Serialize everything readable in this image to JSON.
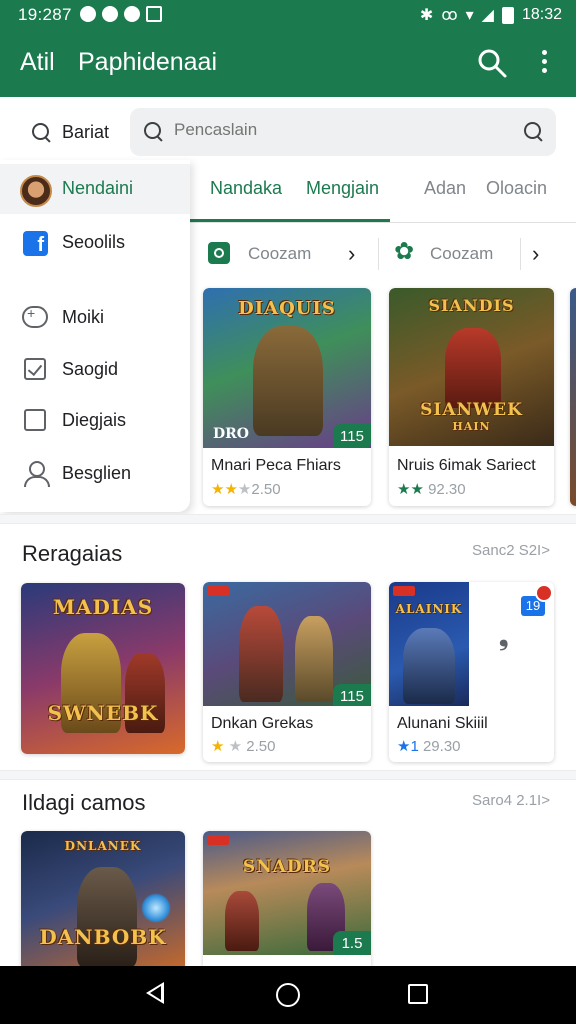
{
  "status_bar": {
    "time_left": "19:287",
    "time_right": "18:32"
  },
  "app_bar": {
    "brand": "Atil",
    "title": "Paphidenaai",
    "search_icon": "search-icon",
    "more_icon": "more-vert-icon"
  },
  "search": {
    "left_label": "Bariat",
    "placeholder": "Pencaslain"
  },
  "drawer": {
    "items": [
      {
        "label": "Nendaini",
        "icon": "avatar"
      },
      {
        "label": "Seoolils",
        "icon": "facebook-icon"
      },
      {
        "label": "Moiki",
        "icon": "gamepad-icon"
      },
      {
        "label": "Saogid",
        "icon": "checkbox-icon"
      },
      {
        "label": "Diegjais",
        "icon": "square-icon"
      },
      {
        "label": "Besglien",
        "icon": "person-icon"
      }
    ]
  },
  "tabs": [
    {
      "label": "Nandaka"
    },
    {
      "label": "Mengjain"
    },
    {
      "label": "Adan"
    },
    {
      "label": "Oloacin"
    }
  ],
  "chips": [
    {
      "label": "Coozam"
    },
    {
      "label": "Coozam"
    }
  ],
  "featured": {
    "cards": [
      {
        "art_title": "DIAQUIS",
        "art_sub": "DRO",
        "badge": "115",
        "name": "Mnari Peca Fhiars",
        "rating": "2.50"
      },
      {
        "art_title": "SIANDIS",
        "art_sub": "SIANWEK",
        "art_sub2": "HAIN",
        "badge": "",
        "name": "Nruis 6imak Sariect",
        "rating": "92.30"
      }
    ]
  },
  "section1": {
    "title": "Reragaias",
    "more": "Sanc2 S2I>",
    "cards": [
      {
        "art_title": "MADIAS",
        "art_sub": "SWNEBK",
        "name": "",
        "rating": ""
      },
      {
        "art_title": "",
        "badge": "115",
        "name": "Dnkan Grekas",
        "rating": "2.50"
      },
      {
        "art_title": "ALAINIK",
        "badge": "19",
        "name": "Alunani Skiiil",
        "rating": "29.30"
      }
    ]
  },
  "section2": {
    "title": "Ildagi camos",
    "more": "Saro4 2.1I>",
    "cards": [
      {
        "art_title": "DNLANEK",
        "art_sub": "DANBOBK",
        "name": ""
      },
      {
        "art_title": "SNADRS",
        "badge": "1.5",
        "name": ""
      }
    ]
  },
  "colors": {
    "primary": "#1c7a4f",
    "star": "#f4b400",
    "accent_blue": "#1a73e8"
  }
}
